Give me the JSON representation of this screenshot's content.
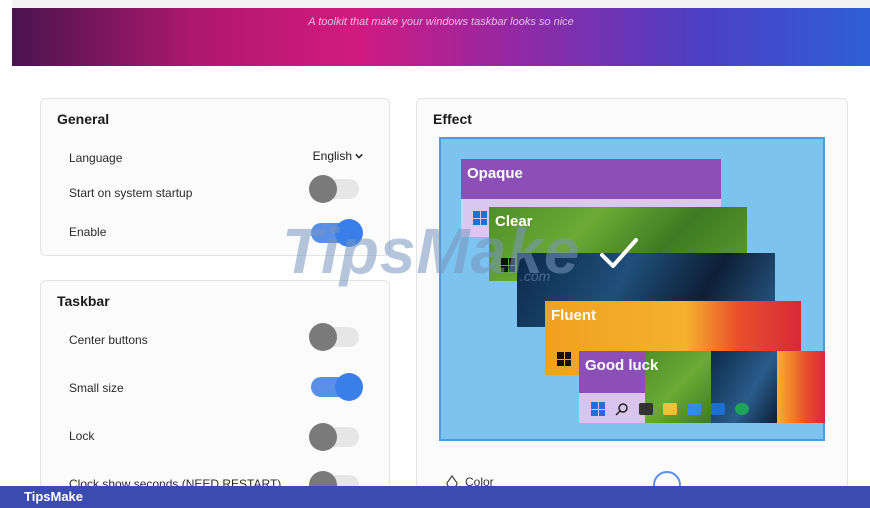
{
  "banner": {
    "tagline": "A toolkit that make your windows taskbar looks so nice"
  },
  "general": {
    "title": "General",
    "language_label": "Language",
    "language_value": "English",
    "startup_label": "Start on system startup",
    "startup_on": false,
    "enable_label": "Enable",
    "enable_on": true
  },
  "taskbar": {
    "title": "Taskbar",
    "center_label": "Center buttons",
    "center_on": false,
    "small_label": "Small size",
    "small_on": true,
    "lock_label": "Lock",
    "lock_on": false,
    "clock_label": "Clock show seconds (NEED RESTART)",
    "clock_on": false
  },
  "effect": {
    "title": "Effect",
    "styles": [
      "Opaque",
      "Clear",
      "Fluent",
      "Good luck"
    ],
    "selected_style": "Clear",
    "color_label": "Color"
  },
  "watermark": {
    "text": "TipsMake",
    "suffix": ".com"
  },
  "footer": {
    "brand": "TipsMake"
  },
  "colors": {
    "accent": "#3a7fe8",
    "banner_magenta": "#d11a7f",
    "footer": "#3c4bb0",
    "preview_bg": "#7cc4ef"
  },
  "icons": [
    "chevron-down-icon",
    "checkmark-icon",
    "windows-logo-icon",
    "search-icon",
    "taskview-icon",
    "file-explorer-icon",
    "calendar-icon",
    "mail-icon",
    "edge-icon",
    "color-drop-icon"
  ]
}
